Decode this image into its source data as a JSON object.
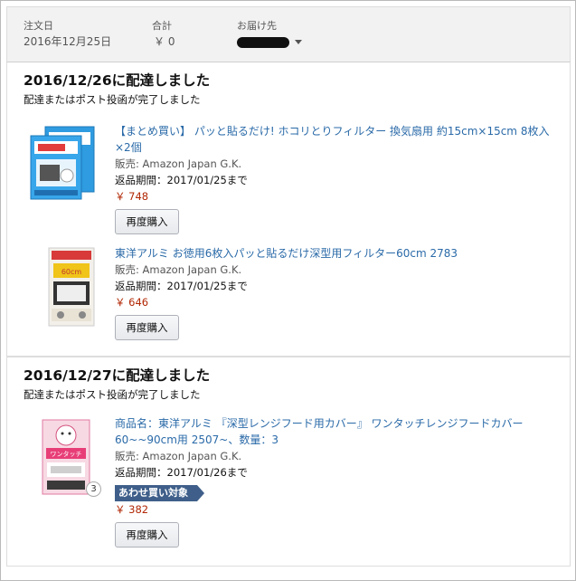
{
  "order_header": {
    "order_date_label": "注文日",
    "order_date": "2016年12月25日",
    "total_label": "合計",
    "total": "￥ 0",
    "ship_to_label": "お届け先"
  },
  "shipments": [
    {
      "title": "2016/12/26に配達しました",
      "subtitle": "配達またはポスト投函が完了しました",
      "items": [
        {
          "title": "【まとめ買い】 パッと貼るだけ! ホコリとりフィルター 換気扇用 約15cm×15cm 8枚入×2個",
          "seller": "販売: Amazon Japan G.K.",
          "return_period": "返品期間：2017/01/25まで",
          "price": "￥ 748",
          "buy_again": "再度購入"
        },
        {
          "title": "東洋アルミ お徳用6枚入パッと貼るだけ深型用フィルター60cm 2783",
          "seller": "販売: Amazon Japan G.K.",
          "return_period": "返品期間：2017/01/25まで",
          "price": "￥ 646",
          "buy_again": "再度購入"
        }
      ]
    },
    {
      "title": "2016/12/27に配達しました",
      "subtitle": "配達またはポスト投函が完了しました",
      "items": [
        {
          "title": "商品名：東洋アルミ 『深型レンジフード用カバー』 ワンタッチレンジフードカバー 60~~90cm用 2507~、数量：3",
          "seller": "販売: Amazon Japan G.K.",
          "return_period": "返品期間：2017/01/26まで",
          "badge": "あわせ買い対象",
          "price": "￥ 382",
          "buy_again": "再度購入",
          "quantity": "3"
        }
      ]
    }
  ],
  "colors": {
    "link": "#2a6aa8",
    "price": "#b12704",
    "badge": "#3f5f8a",
    "header_bg": "#f2f2f2"
  },
  "icons": [
    "product-thumbnail-filter-pack",
    "product-thumbnail-deep-filter",
    "product-thumbnail-range-cover",
    "caret-down-icon"
  ]
}
